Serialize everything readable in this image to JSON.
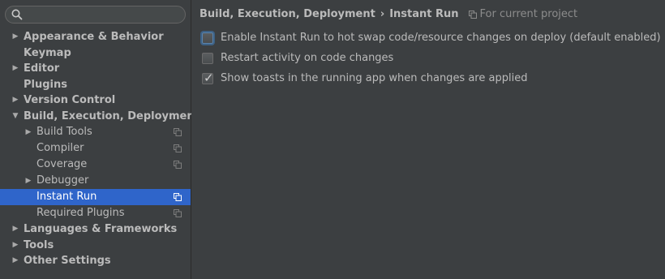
{
  "search": {
    "placeholder": "",
    "value": ""
  },
  "sidebar": {
    "items": [
      {
        "label": "Appearance & Behavior",
        "level": 0,
        "expandable": true,
        "expanded": false
      },
      {
        "label": "Keymap",
        "level": 0,
        "expandable": false
      },
      {
        "label": "Editor",
        "level": 0,
        "expandable": true,
        "expanded": false
      },
      {
        "label": "Plugins",
        "level": 0,
        "expandable": false
      },
      {
        "label": "Version Control",
        "level": 0,
        "expandable": true,
        "expanded": false
      },
      {
        "label": "Build, Execution, Deployment",
        "level": 0,
        "expandable": true,
        "expanded": true
      },
      {
        "label": "Build Tools",
        "level": 1,
        "expandable": true,
        "expanded": false,
        "project_icon": true
      },
      {
        "label": "Compiler",
        "level": 1,
        "expandable": false,
        "project_icon": true
      },
      {
        "label": "Coverage",
        "level": 1,
        "expandable": false,
        "project_icon": true
      },
      {
        "label": "Debugger",
        "level": 1,
        "expandable": true,
        "expanded": false
      },
      {
        "label": "Instant Run",
        "level": 1,
        "expandable": false,
        "project_icon": true,
        "selected": true
      },
      {
        "label": "Required Plugins",
        "level": 1,
        "expandable": false,
        "project_icon": true
      },
      {
        "label": "Languages & Frameworks",
        "level": 0,
        "expandable": true,
        "expanded": false
      },
      {
        "label": "Tools",
        "level": 0,
        "expandable": true,
        "expanded": false
      },
      {
        "label": "Other Settings",
        "level": 0,
        "expandable": true,
        "expanded": false
      }
    ]
  },
  "breadcrumb": {
    "parent": "Build, Execution, Deployment",
    "separator": "›",
    "current": "Instant Run",
    "scope": "For current project"
  },
  "options": [
    {
      "label": "Enable Instant Run to hot swap code/resource changes on deploy (default enabled)",
      "checked": false,
      "focused": true
    },
    {
      "label": "Restart activity on code changes",
      "checked": false
    },
    {
      "label": "Show toasts in the running app when changes are applied",
      "checked": true
    }
  ],
  "icons": {
    "search": "search-icon",
    "expand": "triangle-right-icon",
    "expanded": "triangle-down-icon",
    "project": "project-scope-icon"
  },
  "colors": {
    "background": "#3c3f41",
    "selection": "#2f65ca",
    "text": "#bbbbbb",
    "muted_text": "#8c8c8c"
  }
}
